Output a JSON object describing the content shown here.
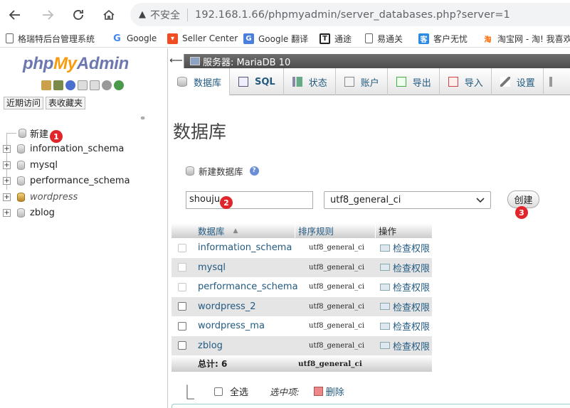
{
  "browser": {
    "security_label": "不安全",
    "url": "192.168.1.66/phpmyadmin/server_databases.php?server=1",
    "bookmarks": [
      {
        "label": "格瑞特后台管理系统",
        "icon": "page-icon"
      },
      {
        "label": "Google",
        "icon": "google-icon"
      },
      {
        "label": "Seller Center",
        "icon": "seller-icon"
      },
      {
        "label": "Google 翻译",
        "icon": "translate-icon"
      },
      {
        "label": "通途",
        "icon": "tongtu-icon"
      },
      {
        "label": "易通关",
        "icon": "page-icon"
      },
      {
        "label": "客户无忧",
        "icon": "kehu-icon"
      },
      {
        "label": "淘宝网 - 淘! 我喜欢",
        "icon": "taobao-icon"
      }
    ]
  },
  "left": {
    "logo": {
      "php": "php",
      "my": "My",
      "admin": "Admin"
    },
    "recent_tab": "近期访问",
    "favorites_tab": "表收藏夹",
    "tree": [
      {
        "label": "新建",
        "italic": false
      },
      {
        "label": "information_schema",
        "italic": false
      },
      {
        "label": "mysql",
        "italic": false
      },
      {
        "label": "performance_schema",
        "italic": false
      },
      {
        "label": "wordpress",
        "italic": true
      },
      {
        "label": "zblog",
        "italic": false
      }
    ]
  },
  "right": {
    "server_label": "服务器: MariaDB 10",
    "tabs": [
      {
        "label": "数据库",
        "icon": "database-icon"
      },
      {
        "label": "SQL",
        "icon": "sql-icon"
      },
      {
        "label": "状态",
        "icon": "status-icon"
      },
      {
        "label": "账户",
        "icon": "accounts-icon"
      },
      {
        "label": "导出",
        "icon": "export-icon"
      },
      {
        "label": "导入",
        "icon": "import-icon"
      },
      {
        "label": "设置",
        "icon": "settings-icon"
      }
    ],
    "page_title": "数据库",
    "new_db_label": "新建数据库",
    "db_name_value": "shouju",
    "collation_value": "utf8_general_ci",
    "create_button": "创建",
    "table": {
      "headers": {
        "name": "数据库",
        "collation": "排序规则",
        "action": "操作"
      },
      "rows": [
        {
          "name": "information_schema",
          "collation": "utf8_general_ci",
          "action": "检查权限",
          "enabled": false
        },
        {
          "name": "mysql",
          "collation": "utf8_general_ci",
          "action": "检查权限",
          "enabled": false
        },
        {
          "name": "performance_schema",
          "collation": "utf8_general_ci",
          "action": "检查权限",
          "enabled": false
        },
        {
          "name": "wordpress_2",
          "collation": "utf8_general_ci",
          "action": "检查权限",
          "enabled": true
        },
        {
          "name": "wordpress_ma",
          "collation": "utf8_general_ci",
          "action": "检查权限",
          "enabled": true
        },
        {
          "name": "zblog",
          "collation": "utf8_general_ci",
          "action": "检查权限",
          "enabled": true
        }
      ],
      "footer": {
        "total": "总计: 6",
        "collation": "utf8_general_ci"
      }
    },
    "bulk": {
      "select_all": "全选",
      "with_selected": "选中项:",
      "delete": "删除"
    }
  },
  "annotations": [
    "1",
    "2",
    "3"
  ]
}
